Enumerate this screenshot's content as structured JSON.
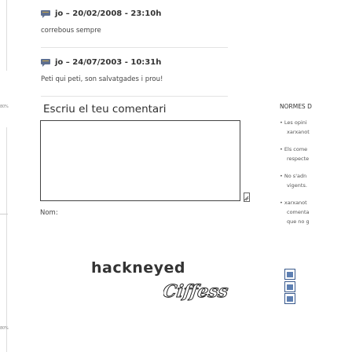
{
  "sidebar_left": {
    "pct_labels": [
      "80%",
      "80%"
    ]
  },
  "comments": [
    {
      "author": "jo",
      "date": "20/02/2008",
      "time": "23:10h",
      "text": "correbous sempre"
    },
    {
      "author": "jo",
      "date": "24/07/2003",
      "time": "10:31h",
      "text": "Peti qui peti, son salvatgades i prou!"
    }
  ],
  "form": {
    "heading": "Escriu el teu comentari",
    "textarea_value": "",
    "name_label": "Nom:",
    "captcha_word": "hackneyed",
    "captcha_image_text": "Ciffess"
  },
  "rules_panel": {
    "title": "NORMES D",
    "items": [
      {
        "lines": [
          "• Les opini",
          "xarxanot"
        ]
      },
      {
        "lines": [
          "• Els come",
          "respecte"
        ]
      },
      {
        "lines": [
          "• No s'adn",
          "vigents."
        ]
      },
      {
        "lines": [
          "• xarxanot",
          "comenta",
          "que no g"
        ]
      }
    ]
  },
  "emoji_buttons": [
    "emoticon-1",
    "emoticon-2",
    "emoticon-3"
  ]
}
